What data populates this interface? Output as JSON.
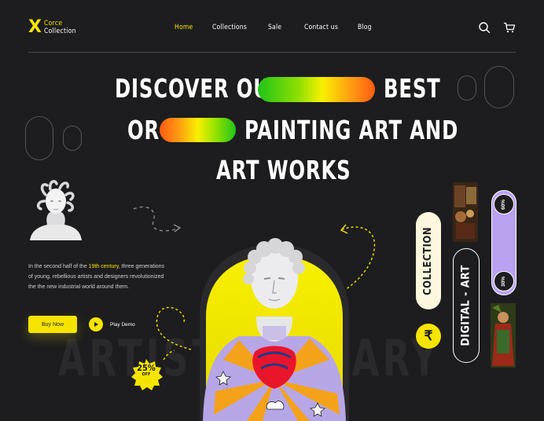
{
  "brand": {
    "line1": "Corce",
    "line2": "Collection"
  },
  "nav": {
    "items": [
      "Home",
      "Collections",
      "Sale",
      "Contact us",
      "Blog"
    ],
    "active": "Home"
  },
  "header_icons": [
    "search-icon",
    "cart-icon"
  ],
  "headline": {
    "line1a": "DISCOVER OUR",
    "line1b": "BEST",
    "line2a": "OR",
    "line2b": "PAINTING ART AND",
    "line3": "ART WORKS"
  },
  "intro": {
    "prefix": "In the second half of the ",
    "highlight": "19th century",
    "suffix": ", three generations of young, rebellious artists and designers revolutionized the  the new industrial world around them."
  },
  "cta": {
    "buy": "Buy Now",
    "play": "Play Demo"
  },
  "background_text": "ARTIST GALLARY",
  "side": {
    "collection": "COLLECTION",
    "digital_art": "DIGITAL - ART",
    "currency_icon": "₹"
  },
  "discounts": {
    "top": "60%",
    "bottom": "30%"
  },
  "badge": {
    "big": "25%",
    "small": "OFF"
  },
  "colors": {
    "accent": "#f5e400",
    "background": "#1d1d1f",
    "lavender": "#b9a2f0",
    "gradient_green": "#22c41c",
    "gradient_orange": "#ff6a10"
  }
}
